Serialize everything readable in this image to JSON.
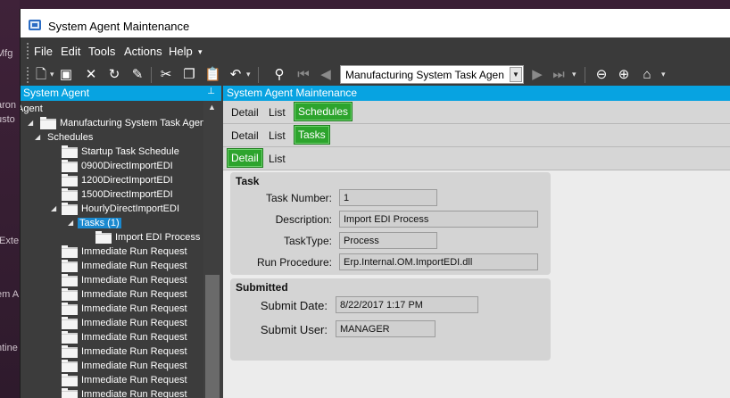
{
  "desktop": {
    "fragments": [
      "Mfg",
      "aron",
      "usto",
      "/Exte",
      "em A",
      "ntine"
    ]
  },
  "window": {
    "title": "System Agent Maintenance"
  },
  "menu": {
    "items": [
      "File",
      "Edit",
      "Tools",
      "Actions",
      "Help"
    ],
    "overflow": "▾"
  },
  "toolbar": {
    "icons": [
      "new-icon",
      "save-icon",
      "delete-icon",
      "refresh-icon",
      "clear-icon",
      "cut-icon",
      "copy-icon",
      "paste-icon",
      "undo-icon",
      "search-icon",
      "first-record-icon",
      "prev-record-icon",
      "next-record-icon",
      "last-record-icon",
      "back-icon",
      "forward-icon",
      "home-icon"
    ],
    "nav_value": "Manufacturing System Task Agen"
  },
  "left_panel": {
    "title": "System Agent",
    "pin": "⊥",
    "tree": [
      {
        "label": "Agent",
        "expander": "",
        "folder": false,
        "selected": false
      },
      {
        "label": "Manufacturing System Task Agent",
        "expander": "◢",
        "folder": true,
        "selected": false
      },
      {
        "label": "Schedules",
        "expander": "◢",
        "folder": false,
        "selected": false
      },
      {
        "label": "Startup Task Schedule",
        "expander": "",
        "folder": true,
        "selected": false
      },
      {
        "label": "0900DirectImportEDI",
        "expander": "",
        "folder": true,
        "selected": false
      },
      {
        "label": "1200DirectImportEDI",
        "expander": "",
        "folder": true,
        "selected": false
      },
      {
        "label": "1500DirectImportEDI",
        "expander": "",
        "folder": true,
        "selected": false
      },
      {
        "label": "HourlyDirectImportEDI",
        "expander": "◢",
        "folder": true,
        "selected": false
      },
      {
        "label": "Tasks (1)",
        "expander": "◢",
        "folder": false,
        "selected": true
      },
      {
        "label": "Import EDI Process",
        "expander": "",
        "folder": true,
        "selected": false
      },
      {
        "label": "Immediate Run Request",
        "expander": "",
        "folder": true,
        "selected": false
      },
      {
        "label": "Immediate Run Request",
        "expander": "",
        "folder": true,
        "selected": false
      },
      {
        "label": "Immediate Run Request",
        "expander": "",
        "folder": true,
        "selected": false
      },
      {
        "label": "Immediate Run Request",
        "expander": "",
        "folder": true,
        "selected": false
      },
      {
        "label": "Immediate Run Request",
        "expander": "",
        "folder": true,
        "selected": false
      },
      {
        "label": "Immediate Run Request",
        "expander": "",
        "folder": true,
        "selected": false
      },
      {
        "label": "Immediate Run Request",
        "expander": "",
        "folder": true,
        "selected": false
      },
      {
        "label": "Immediate Run Request",
        "expander": "",
        "folder": true,
        "selected": false
      },
      {
        "label": "Immediate Run Request",
        "expander": "",
        "folder": true,
        "selected": false
      },
      {
        "label": "Immediate Run Request",
        "expander": "",
        "folder": true,
        "selected": false
      },
      {
        "label": "Immediate Run Request",
        "expander": "",
        "folder": true,
        "selected": false
      }
    ]
  },
  "right_panel": {
    "title": "System Agent Maintenance",
    "tabrow1": {
      "detail": "Detail",
      "list": "List",
      "active": "Schedules"
    },
    "tabrow2": {
      "detail": "Detail",
      "list": "List",
      "active": "Tasks"
    },
    "tabrow3": {
      "active": "Detail",
      "list": "List"
    },
    "task_group": {
      "title": "Task",
      "task_number_label": "Task Number:",
      "task_number": "1",
      "description_label": "Description:",
      "description": "Import EDI Process",
      "tasktype_label": "TaskType:",
      "tasktype": "Process",
      "run_procedure_label": "Run Procedure:",
      "run_procedure": "Erp.Internal.OM.ImportEDI.dll"
    },
    "submitted_group": {
      "title": "Submitted",
      "submit_date_label": "Submit Date:",
      "submit_date": "8/22/2017 1:17 PM",
      "submit_user_label": "Submit User:",
      "submit_user": "MANAGER"
    }
  }
}
